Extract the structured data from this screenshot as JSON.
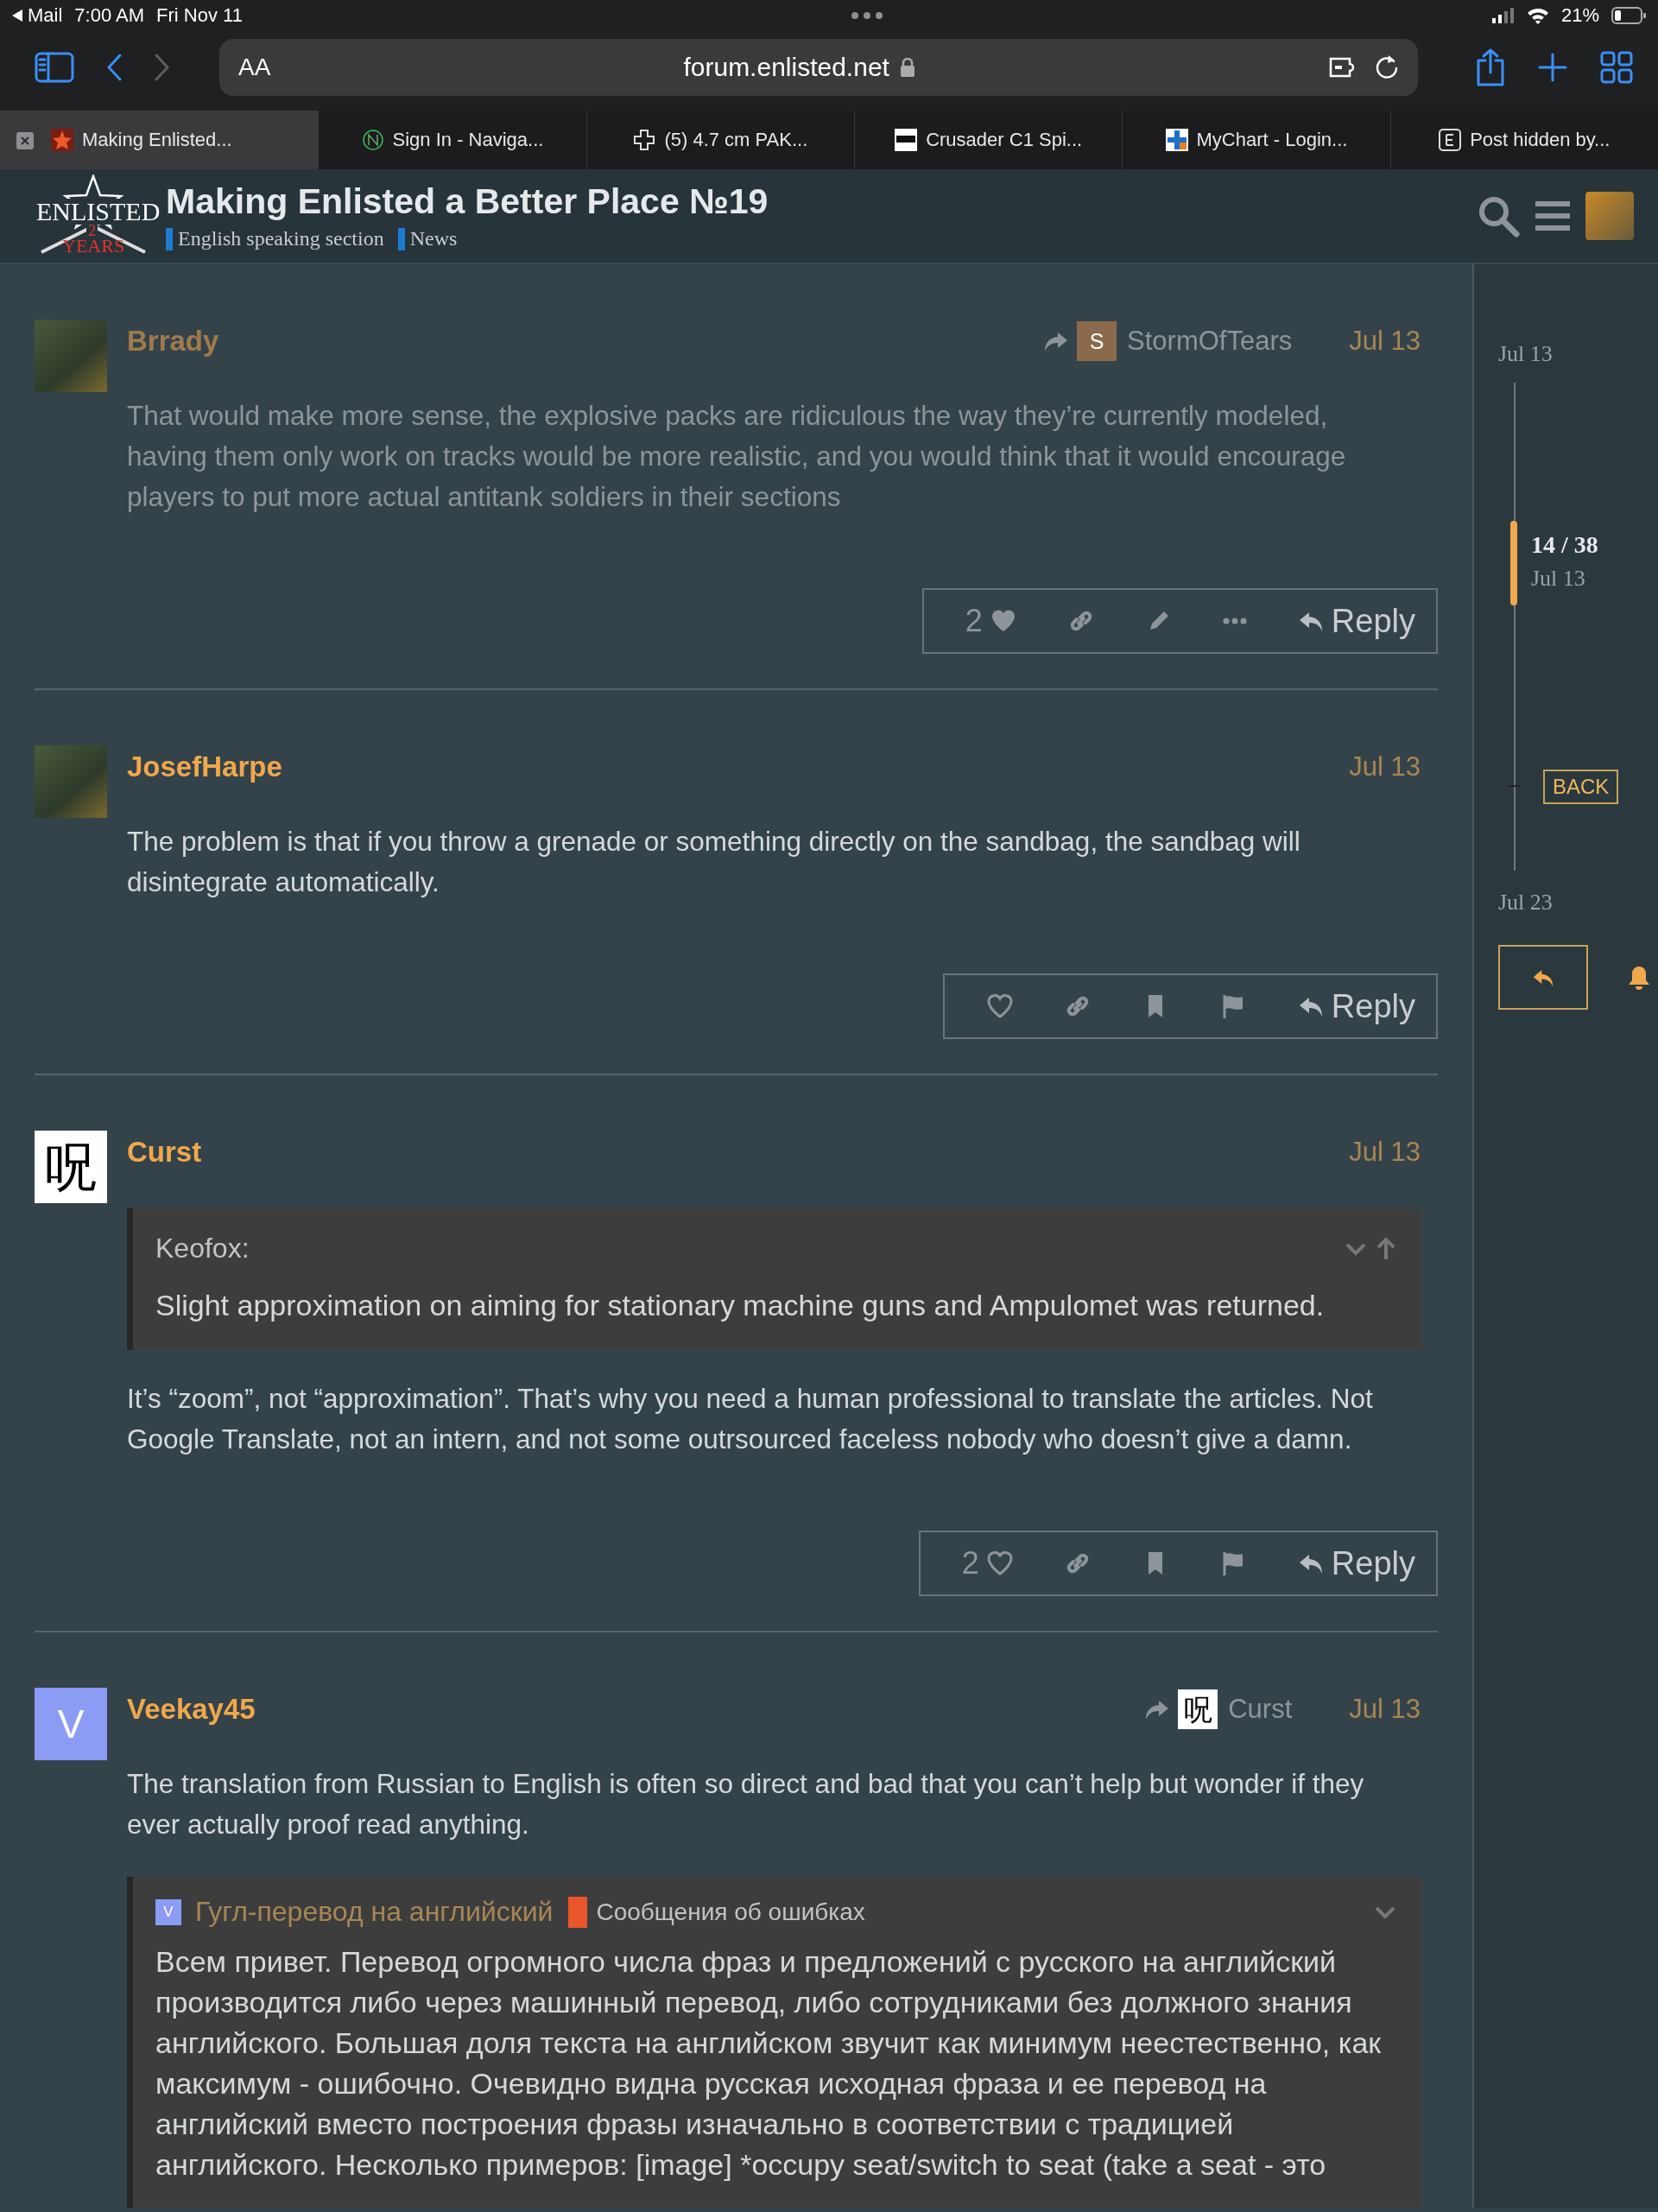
{
  "status_bar": {
    "back_app": "Mail",
    "time": "7:00 AM",
    "date": "Fri Nov 11",
    "battery": "21%"
  },
  "browser": {
    "text_size": "AA",
    "url": "forum.enlisted.net"
  },
  "browser_tabs": [
    {
      "title": "Making Enlisted...",
      "selected": true
    },
    {
      "title": "Sign In - Naviga...",
      "selected": false
    },
    {
      "title": "(5) 4.7 cm PAK...",
      "selected": false
    },
    {
      "title": "Crusader C1 Spi...",
      "selected": false
    },
    {
      "title": "MyChart - Login...",
      "selected": false
    },
    {
      "title": "Post hidden by...",
      "selected": false
    }
  ],
  "forum": {
    "logo": [
      "ENLISTED",
      "2",
      "YEARS"
    ],
    "title": "Making Enlisted a Better Place №19",
    "categories": [
      {
        "name": "English speaking section",
        "color": "#1e7ccf"
      },
      {
        "name": "News",
        "color": "#1e7ccf"
      }
    ]
  },
  "posts": [
    {
      "username": "Brrady",
      "avatar": {
        "kind": "image"
      },
      "faded": true,
      "reply_to": {
        "name": "StormOfTears",
        "avatar": {
          "kind": "letter",
          "text": "S",
          "color": "#8a6a4b"
        }
      },
      "date": "Jul 13",
      "body": [
        "That would make more sense, the explosive packs are ridiculous the way they’re currently modeled, having them only work on tracks would be more realistic, and you would think that it would encourage players to put more actual antitank soldiers in their sections"
      ],
      "actions": [
        {
          "kind": "like",
          "count": "2",
          "liked": true
        },
        {
          "kind": "link"
        },
        {
          "kind": "edit"
        },
        {
          "kind": "more"
        },
        {
          "kind": "reply",
          "label": "Reply"
        }
      ]
    },
    {
      "username": "JosefHarpe",
      "avatar": {
        "kind": "image"
      },
      "faded": false,
      "date": "Jul 13",
      "body": [
        "The problem is that if you throw a grenade or something directly on the sandbag, the sandbag will disintegrate automatically."
      ],
      "actions": [
        {
          "kind": "like",
          "liked": false
        },
        {
          "kind": "link"
        },
        {
          "kind": "bookmark"
        },
        {
          "kind": "flag"
        },
        {
          "kind": "reply",
          "label": "Reply"
        }
      ]
    },
    {
      "username": "Curst",
      "avatar": {
        "kind": "glyph",
        "text": "呪"
      },
      "faded": false,
      "date": "Jul 13",
      "quote": {
        "author": "Keofox:",
        "text": "Slight approximation on aiming for stationary machine guns and Ampulomet was returned."
      },
      "body": [
        "It’s “zoom”, not “approximation”. That’s why you need a human professional to translate the articles. Not Google Translate, not an intern, and not some outrsourced faceless nobody who doesn’t give a damn."
      ],
      "actions": [
        {
          "kind": "like",
          "count": "2",
          "liked": false
        },
        {
          "kind": "link"
        },
        {
          "kind": "bookmark"
        },
        {
          "kind": "flag"
        },
        {
          "kind": "reply",
          "label": "Reply"
        }
      ]
    },
    {
      "username": "Veekay45",
      "avatar": {
        "kind": "letter",
        "text": "V",
        "color": "#8c9cf5"
      },
      "faded": false,
      "reply_to": {
        "name": "Curst",
        "avatar": {
          "kind": "glyph",
          "text": "呪"
        }
      },
      "date": "Jul 13",
      "body": [
        "The translation from Russian to English is often so direct and bad that you can’t help but wonder if they ever actually proof read anything."
      ],
      "topic_quote": {
        "avatar": {
          "kind": "letter",
          "text": "V",
          "color": "#8c9cf5"
        },
        "topic": "Гугл-перевод на английский",
        "category": {
          "name": "Сообщения об ошибках",
          "color": "#e9562b"
        },
        "text": "Всем привет. Перевод огромного числа фраз и предложений с русского на английский производится либо через машинный перевод, либо сотрудниками без должного знания английского. Большая доля текста на английском звучит как минимум неестественно, как максимум - ошибочно. Очевидно видна русская исходная фраза и ее перевод на английский вместо построения фразы изначально в соответствии с традицией английского. Несколько примеров: [image] *occupy seat/switch to seat (take a seat - это"
      }
    }
  ],
  "timeline": {
    "start_date": "Jul 13",
    "position": "14 / 38",
    "position_date": "Jul 13",
    "back": "BACK",
    "end_date": "Jul 23"
  }
}
